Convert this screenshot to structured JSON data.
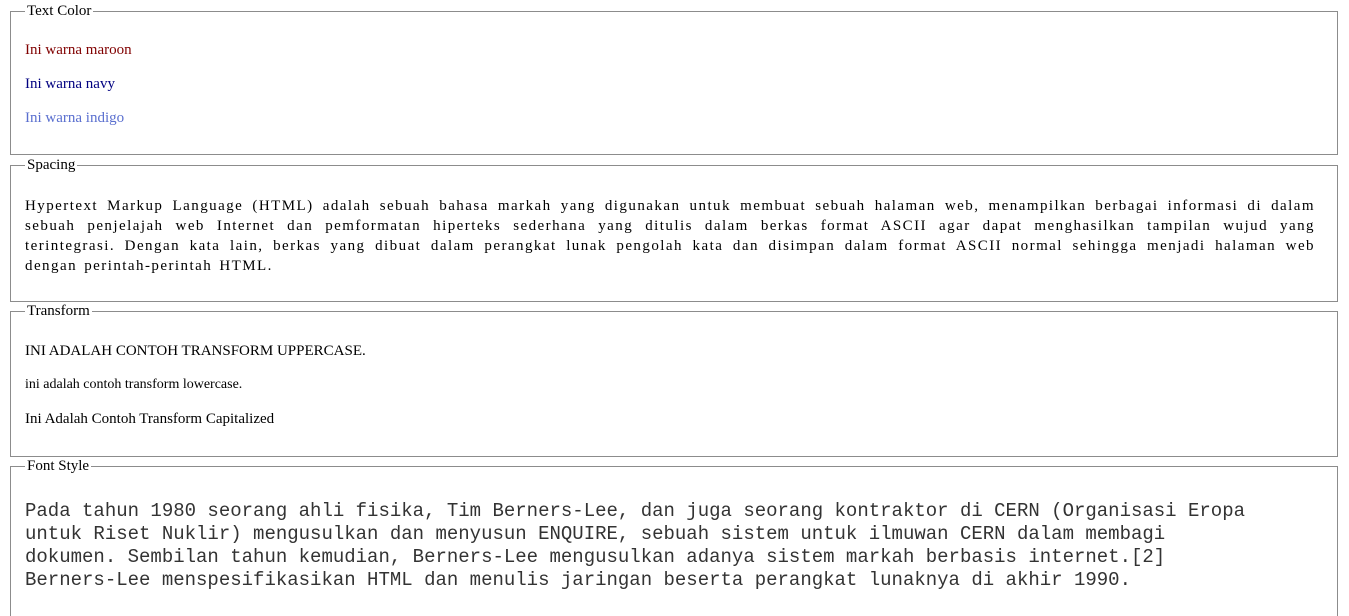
{
  "sections": {
    "text_color": {
      "legend": "Text Color",
      "lines": [
        {
          "text": "Ini warna maroon",
          "color": "#800000"
        },
        {
          "text": "Ini warna navy",
          "color": "#000080"
        },
        {
          "text": "Ini warna indigo",
          "color": "#5a6fcf"
        }
      ]
    },
    "spacing": {
      "legend": "Spacing",
      "text": "Hypertext Markup Language (HTML) adalah sebuah bahasa markah yang digunakan untuk membuat sebuah halaman web, menampilkan berbagai informasi di dalam sebuah penjelajah web Internet dan pemformatan hiperteks sederhana yang ditulis dalam berkas format ASCII agar dapat menghasilkan tampilan wujud yang terintegrasi. Dengan kata lain, berkas yang dibuat dalam perangkat lunak pengolah kata dan disimpan dalam format ASCII normal sehingga menjadi halaman web dengan perintah-perintah HTML."
    },
    "transform": {
      "legend": "Transform",
      "uppercase": "INI ADALAH CONTOH TRANSFORM UPPERCASE.",
      "lowercase": "ini adalah contoh transform lowercase.",
      "capitalized": "Ini Adalah Contoh Transform Capitalized"
    },
    "font_style": {
      "legend": "Font Style",
      "lines": [
        "Pada tahun 1980 seorang ahli fisika, Tim Berners-Lee, dan juga seorang kontraktor di CERN (Organisasi Eropa",
        "untuk Riset Nuklir) mengusulkan dan menyusun ENQUIRE, sebuah sistem untuk ilmuwan CERN dalam membagi",
        "dokumen. Sembilan tahun kemudian, Berners-Lee mengusulkan adanya sistem markah berbasis internet.[2]",
        "Berners-Lee menspesifikasikan HTML dan menulis jaringan beserta perangkat lunaknya di akhir 1990."
      ]
    }
  },
  "colors": {
    "border": "#8c8c8c",
    "maroon": "#800000",
    "navy": "#000080",
    "indigo": "#5a6fcf",
    "mono_text": "#333333"
  }
}
